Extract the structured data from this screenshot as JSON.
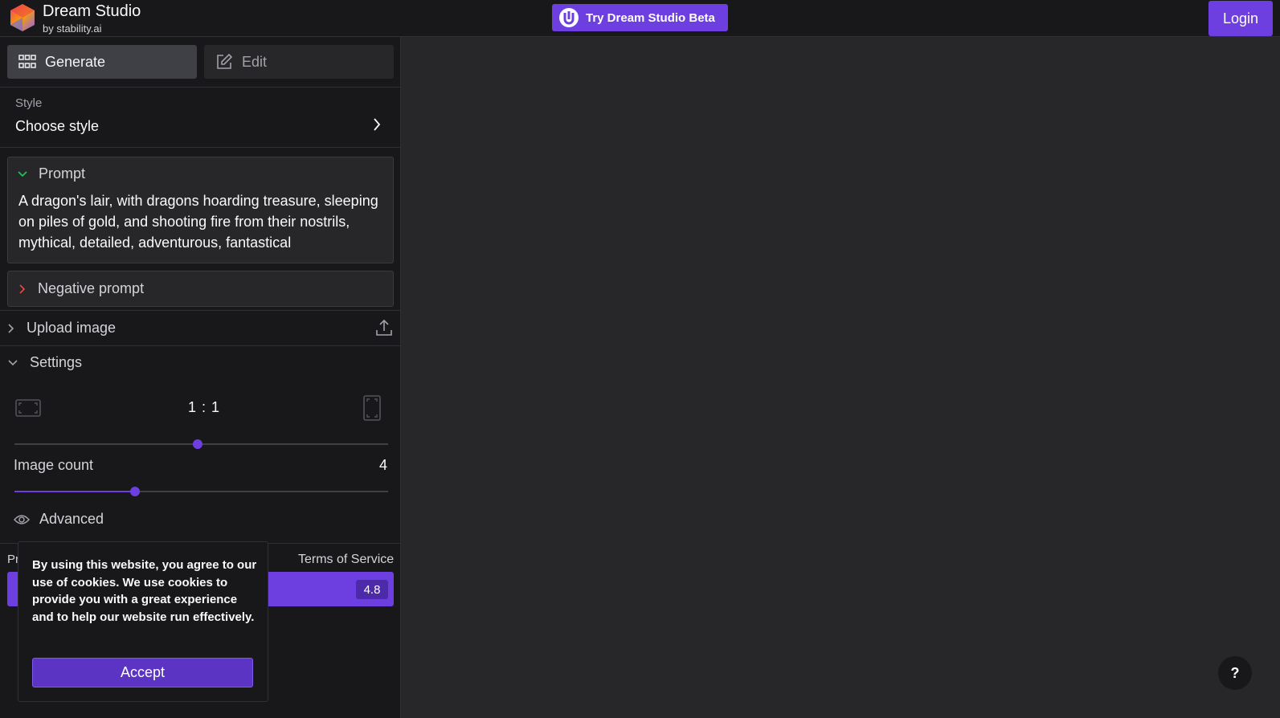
{
  "header": {
    "brand_title": "Dream Studio",
    "brand_subtitle": "by stability.ai",
    "beta_button": "Try Dream Studio Beta",
    "login_button": "Login"
  },
  "tabs": {
    "generate": "Generate",
    "edit": "Edit"
  },
  "style": {
    "label": "Style",
    "value": "Choose style"
  },
  "prompt": {
    "heading": "Prompt",
    "text": "A dragon's lair, with dragons hoarding treasure, sleeping on piles of gold, and shooting fire from their nostrils, mythical, detailed, adventurous, fantastical"
  },
  "negative_prompt": {
    "heading": "Negative prompt"
  },
  "upload": {
    "label": "Upload image"
  },
  "settings": {
    "heading": "Settings",
    "aspect_ratio": "1 : 1",
    "aspect_slider_value": 0.5,
    "image_count_label": "Image count",
    "image_count_value": "4",
    "image_count_slider_value": 0.33,
    "advanced_label": "Advanced"
  },
  "footer": {
    "left_partial": "Pr",
    "terms_link": "Terms of Service",
    "cost": "4.8"
  },
  "cookie_banner": {
    "text": "By using this website, you agree to our use of cookies. We use cookies to provide you with a great experience and to help our website run effectively.",
    "accept_button": "Accept"
  },
  "help_button": "?",
  "colors": {
    "accent": "#6d3fe0",
    "sidebar_bg": "#18181b",
    "canvas_bg": "#27272a"
  }
}
